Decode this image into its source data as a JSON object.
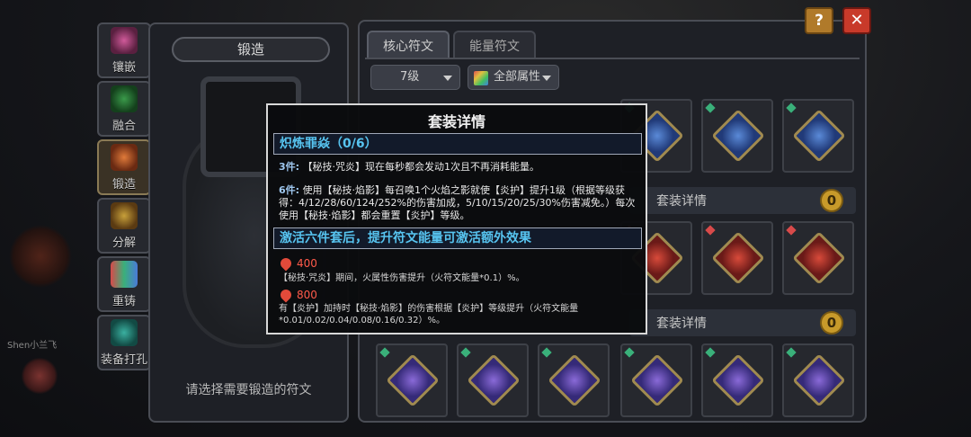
{
  "sidebar": {
    "items": [
      {
        "label": "镶嵌"
      },
      {
        "label": "融合"
      },
      {
        "label": "锻造"
      },
      {
        "label": "分解"
      },
      {
        "label": "重铸"
      },
      {
        "label": "装备打孔"
      }
    ]
  },
  "forge": {
    "title": "锻造",
    "hint": "请选择需要锻造的符文"
  },
  "runes": {
    "tabs": [
      {
        "label": "核心符文"
      },
      {
        "label": "能量符文"
      }
    ],
    "level_select": "7级",
    "attr_select": "全部属性",
    "set_bar_label": "套装详情",
    "set_bar_badge": "0",
    "icons": [
      "blue-rune",
      "red-rune",
      "purple-rune"
    ]
  },
  "buttons": {
    "help": "?",
    "close": "✕"
  },
  "background": {
    "player_name": "Shen小兰飞"
  },
  "dialog": {
    "title": "套装详情",
    "set_name": "炽炼罪焱（0/6）",
    "p3_key": "3件:",
    "p3_text": "【秘技·咒炎】现在每秒都会发动1次且不再消耗能量。",
    "p6_key": "6件:",
    "p6_text": "使用【秘技·焰影】每召唤1个火焰之影就使【炎护】提升1级（根据等级获得：4/12/28/60/124/252%的伤害加成，5/10/15/20/25/30%伤害减免。）每次使用【秘技·焰影】都会重置【炎护】等级。",
    "activate_header": "激活六件套后，提升符文能量可激活额外效果",
    "bonus1_value": "400",
    "bonus1_text": "【秘技·咒炎】期间，火属性伤害提升（火符文能量*0.1）%。",
    "bonus2_value": "800",
    "bonus2_text": "有【炎护】加持时【秘技·焰影】的伤害根据【炎护】等级提升（火符文能量*0.01/0.02/0.04/0.08/0.16/0.32）%。"
  },
  "colors": {
    "accent_cyan": "#57c4f0",
    "fire_red": "#ff5a4a",
    "badge_gold": "#c89a2a"
  }
}
